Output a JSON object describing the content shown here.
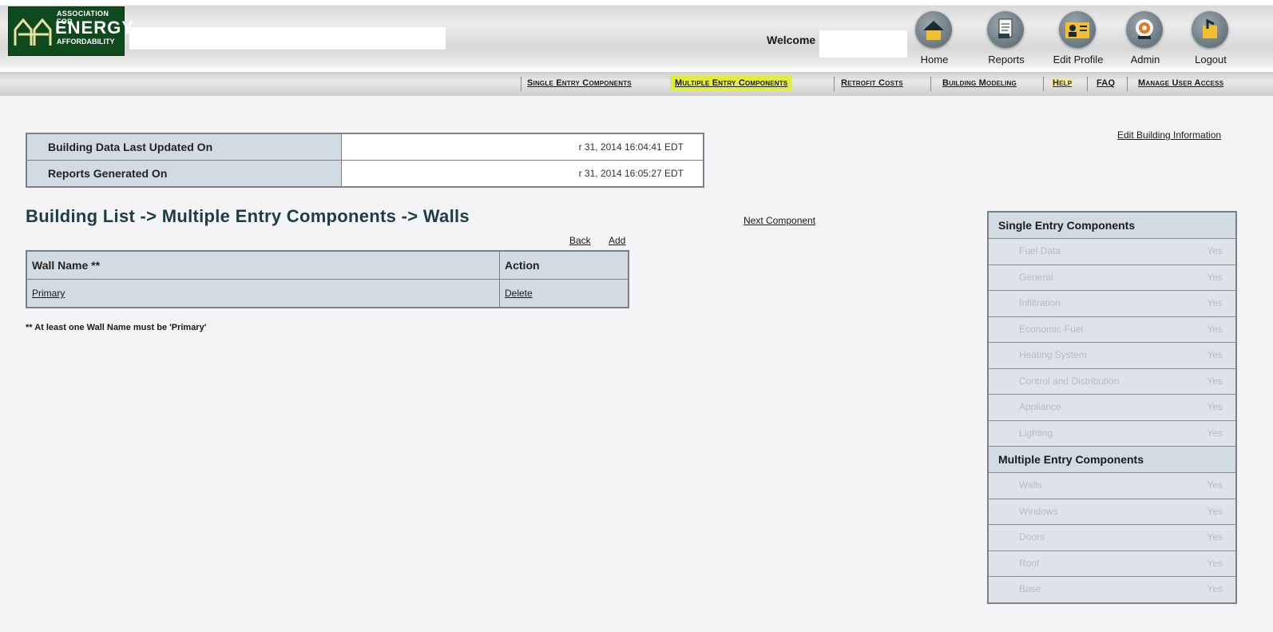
{
  "header": {
    "logo": {
      "line1": "ASSOCIATION FOR",
      "line2": "ENERGY",
      "line3": "AFFORDABILITY"
    },
    "welcome_label": "Welcome",
    "nav_buttons": [
      {
        "label": "Home",
        "icon": "home-icon"
      },
      {
        "label": "Reports",
        "icon": "reports-icon"
      },
      {
        "label": "Edit Profile",
        "icon": "edit-profile-icon"
      },
      {
        "label": "Admin",
        "icon": "admin-icon"
      },
      {
        "label": "Logout",
        "icon": "logout-icon"
      }
    ]
  },
  "menu": {
    "items": [
      {
        "label": "Single Entry Components"
      },
      {
        "label": "Multiple Entry Components"
      },
      {
        "label": "Retrofit Costs"
      },
      {
        "label": "Building Modeling"
      },
      {
        "label": "Help"
      },
      {
        "label": "FAQ"
      },
      {
        "label": "Manage User Access"
      }
    ],
    "active_color": "#e2ec45"
  },
  "info": {
    "rows": [
      {
        "label": "Building Data Last Updated On",
        "value": "r 31, 2014 16:04:41 EDT"
      },
      {
        "label": "Reports Generated On",
        "value": "r 31, 2014 16:05:27 EDT"
      }
    ],
    "edit_link": "Edit Building Information"
  },
  "page": {
    "title": "Building List -> Multiple Entry Components -> Walls",
    "next_component": "Next Component",
    "back": "Back",
    "add": "Add",
    "footnote": "**  At least one Wall Name must be 'Primary'"
  },
  "walls_table": {
    "headers": [
      "Wall Name **",
      "Action"
    ],
    "rows": [
      {
        "name": "Primary",
        "action": "Delete"
      }
    ]
  },
  "side_panel": {
    "single_header": "Single Entry Components",
    "single_items": [
      {
        "name": "Fuel Data",
        "status": "Yes"
      },
      {
        "name": "General",
        "status": "Yes"
      },
      {
        "name": "Infiltration",
        "status": "Yes"
      },
      {
        "name": "Economic-Fuel",
        "status": "Yes"
      },
      {
        "name": "Heating System",
        "status": "Yes"
      },
      {
        "name": "Control and Distribution",
        "status": "Yes"
      },
      {
        "name": "Appliance",
        "status": "Yes"
      },
      {
        "name": "Lighting",
        "status": "Yes"
      }
    ],
    "multiple_header": "Multiple Entry Components",
    "multiple_items": [
      {
        "name": "Walls",
        "status": "Yes"
      },
      {
        "name": "Windows",
        "status": "Yes"
      },
      {
        "name": "Doors",
        "status": "Yes"
      },
      {
        "name": "Roof",
        "status": "Yes"
      },
      {
        "name": "Base",
        "status": "Yes"
      }
    ]
  }
}
